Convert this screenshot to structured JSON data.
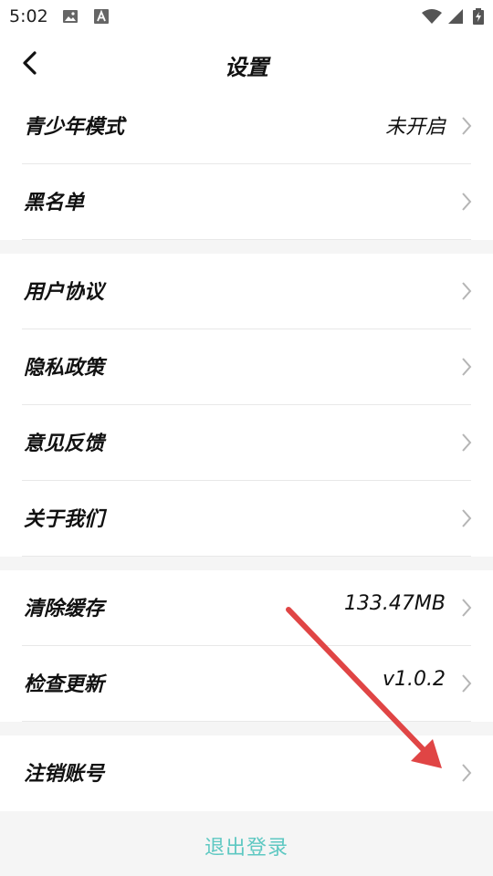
{
  "status_bar": {
    "time": "5:02",
    "icons": [
      "image-icon",
      "a-icon",
      "wifi-icon",
      "signal-icon",
      "battery-icon"
    ]
  },
  "header": {
    "title": "设置",
    "back_icon": "chevron-left-icon"
  },
  "groups": [
    {
      "items": [
        {
          "label": "青少年模式",
          "value": "未开启"
        },
        {
          "label": "黑名单",
          "value": ""
        }
      ]
    },
    {
      "items": [
        {
          "label": "用户协议",
          "value": ""
        },
        {
          "label": "隐私政策",
          "value": ""
        },
        {
          "label": "意见反馈",
          "value": ""
        },
        {
          "label": "关于我们",
          "value": ""
        }
      ]
    },
    {
      "items": [
        {
          "label": "清除缓存",
          "value": "133.47MB"
        },
        {
          "label": "检查更新",
          "value": "v1.0.2"
        }
      ]
    },
    {
      "items": [
        {
          "label": "注销账号",
          "value": ""
        }
      ]
    }
  ],
  "logout": {
    "label": "退出登录"
  },
  "colors": {
    "accent": "#5ec8c2",
    "annotation_arrow": "#e04545",
    "page_background": "#f5f5f5"
  }
}
